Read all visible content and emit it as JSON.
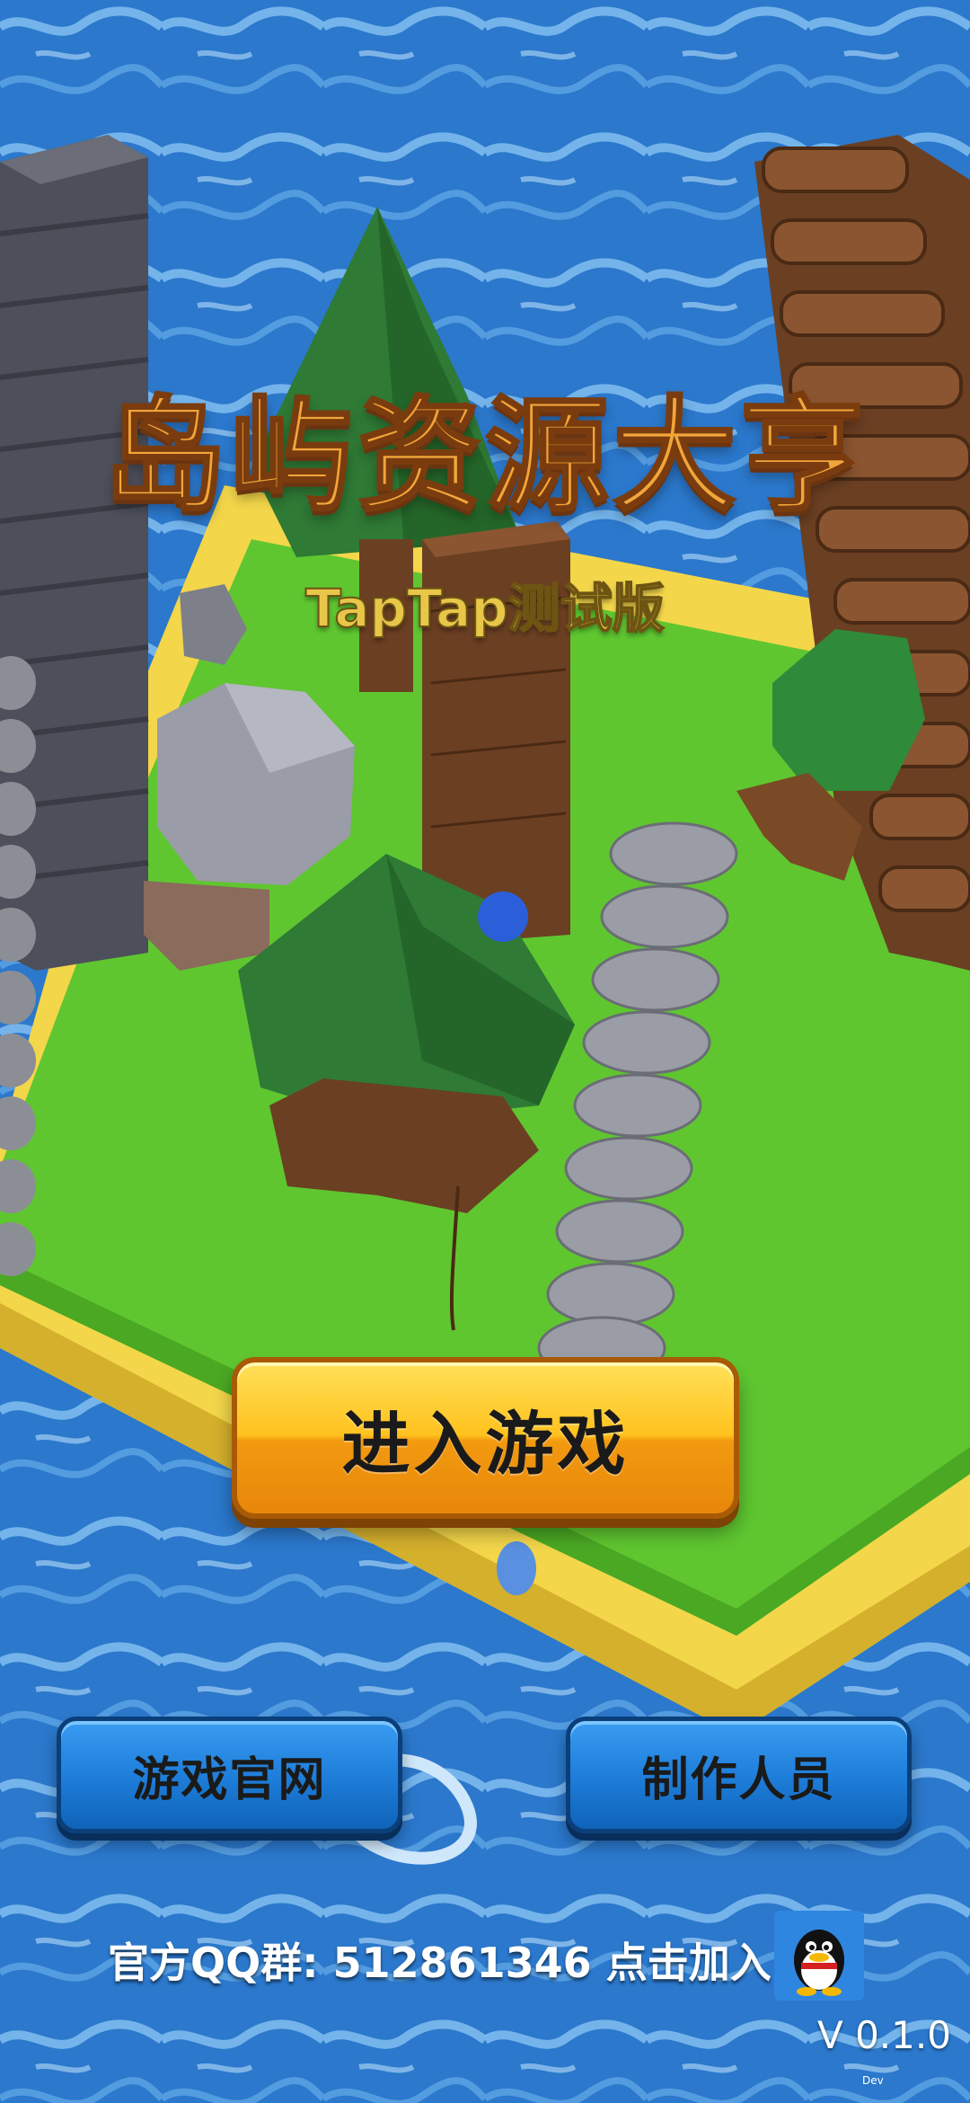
{
  "title": "岛屿资源大亨",
  "subtitle": "TapTap测试版",
  "enter_button": "进入游戏",
  "website_button": "游戏官网",
  "credits_button": "制作人员",
  "qq_group_text": "官方QQ群: 512861346 点击加入",
  "version": "V 0.1.0",
  "watermark": "Dev",
  "colors": {
    "ocean": "#2f7fd0",
    "grass": "#5fc630",
    "sand": "#f3d64a",
    "enter_button": "#ffc21e",
    "blue_button": "#1f7fdb"
  },
  "icons": [
    "qq-penguin-icon"
  ]
}
